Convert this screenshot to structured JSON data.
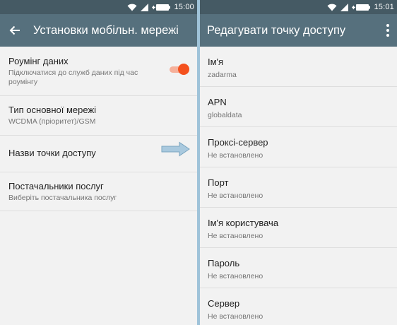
{
  "left": {
    "status": {
      "time": "15:00"
    },
    "toolbar": {
      "title": "Установки мобільн. мережі",
      "back_icon": "arrow-left-icon"
    },
    "items": [
      {
        "title": "Роумінг даних",
        "subtitle_line1": "Підключатися до служб даних під час",
        "subtitle_line2": "роумінгу",
        "toggle_on": true
      },
      {
        "title": "Тип основної мережі",
        "subtitle": "WCDMA (пріоритет)/GSM"
      },
      {
        "title": "Назви точки доступу"
      },
      {
        "title": "Постачальники послуг",
        "subtitle": "Виберіть постачальника послуг"
      }
    ]
  },
  "right": {
    "status": {
      "time": "15:01"
    },
    "toolbar": {
      "title": "Редагувати точку доступу",
      "menu_icon": "more-vert-icon"
    },
    "items": [
      {
        "title": "Ім'я",
        "value": "zadarma"
      },
      {
        "title": "APN",
        "value": "globaldata"
      },
      {
        "title": "Проксі-сервер",
        "value": "Не встановлено"
      },
      {
        "title": "Порт",
        "value": "Не встановлено"
      },
      {
        "title": "Ім'я користувача",
        "value": "Не встановлено"
      },
      {
        "title": "Пароль",
        "value": "Не встановлено"
      },
      {
        "title": "Сервер",
        "value": "Не встановлено"
      }
    ]
  },
  "colors": {
    "statusbar": "#455a64",
    "toolbar": "#56707d",
    "accent": "#f4511e",
    "divider": "#9fc3d9",
    "arrow": "#a9c9de"
  }
}
